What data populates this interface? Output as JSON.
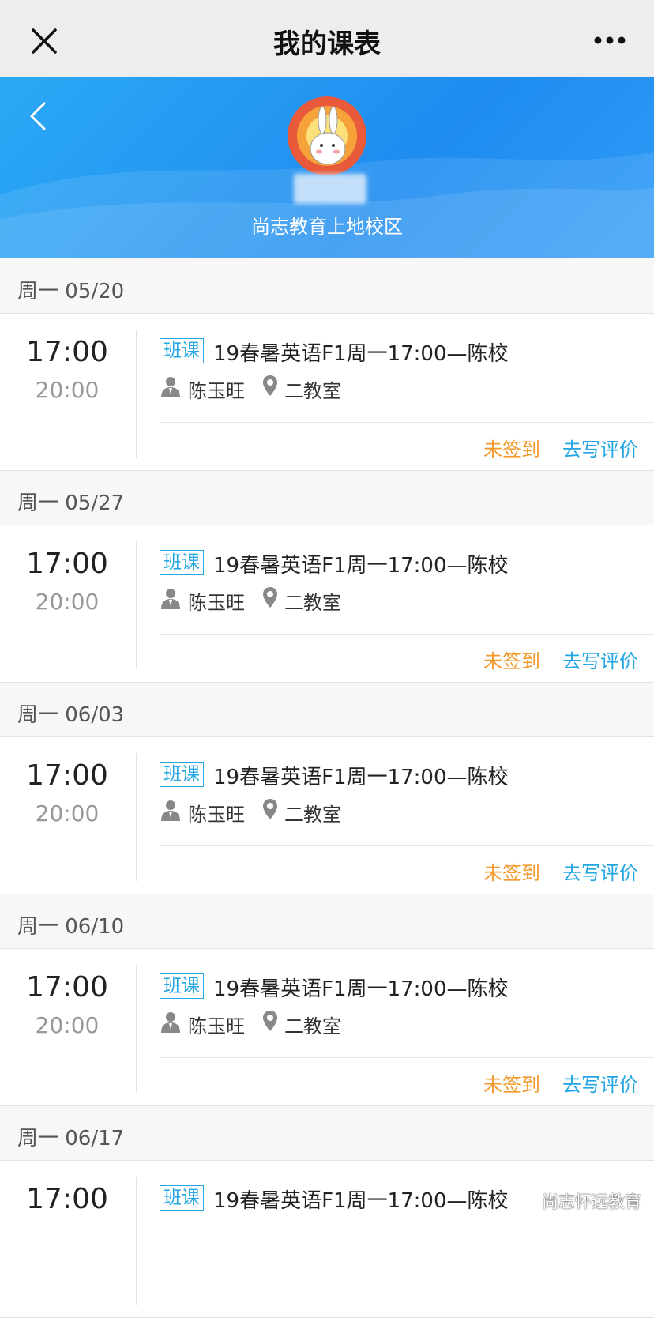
{
  "topbar": {
    "title": "我的课表",
    "close_icon": "close-icon",
    "more_icon": "more-icon"
  },
  "hero": {
    "campus_name": "尚志教育上地校区",
    "back_icon": "chevron-left-icon",
    "avatar": "rabbit-avatar"
  },
  "schedule": [
    {
      "day": "周一 05/20",
      "start": "17:00",
      "end": "20:00",
      "badge": "班课",
      "course": "19春暑英语F1周一17:00—陈校",
      "teacher": "陈玉旺",
      "room": "二教室",
      "sign_status": "未签到",
      "review_label": "去写评价"
    },
    {
      "day": "周一 05/27",
      "start": "17:00",
      "end": "20:00",
      "badge": "班课",
      "course": "19春暑英语F1周一17:00—陈校",
      "teacher": "陈玉旺",
      "room": "二教室",
      "sign_status": "未签到",
      "review_label": "去写评价"
    },
    {
      "day": "周一 06/03",
      "start": "17:00",
      "end": "20:00",
      "badge": "班课",
      "course": "19春暑英语F1周一17:00—陈校",
      "teacher": "陈玉旺",
      "room": "二教室",
      "sign_status": "未签到",
      "review_label": "去写评价"
    },
    {
      "day": "周一 06/10",
      "start": "17:00",
      "end": "20:00",
      "badge": "班课",
      "course": "19春暑英语F1周一17:00—陈校",
      "teacher": "陈玉旺",
      "room": "二教室",
      "sign_status": "未签到",
      "review_label": "去写评价"
    },
    {
      "day": "周一 06/17",
      "start": "17:00",
      "end": "",
      "badge": "班课",
      "course": "19春暑英语F1周一17:00—陈校",
      "teacher": "",
      "room": "",
      "sign_status": "",
      "review_label": ""
    }
  ],
  "watermark": {
    "text": "尚志怀远教育",
    "icon": "wechat-icon"
  },
  "colors": {
    "accent": "#23a6e3",
    "warning": "#f39a2d",
    "hero": "#1f8cf0"
  }
}
